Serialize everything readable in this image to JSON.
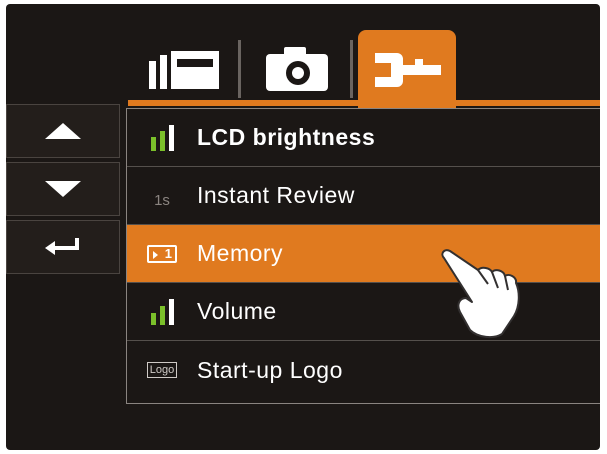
{
  "tabs": [
    {
      "id": "playback",
      "icon": "playback-mode-icon",
      "active": false
    },
    {
      "id": "camera",
      "icon": "camera-icon",
      "active": false
    },
    {
      "id": "settings",
      "icon": "wrench-icon",
      "active": true
    }
  ],
  "nav": [
    {
      "id": "up",
      "icon": "up-arrow-icon"
    },
    {
      "id": "down",
      "icon": "down-arrow-icon"
    },
    {
      "id": "enter",
      "icon": "enter-return-icon"
    }
  ],
  "menu": {
    "items": [
      {
        "label": "LCD brightness",
        "icon": "brightness-bars-icon",
        "selected": false
      },
      {
        "label": "Instant Review",
        "icon": "review-time-icon",
        "icon_text": "1s",
        "selected": false
      },
      {
        "label": "Memory",
        "icon": "memory-card-icon",
        "icon_text": "1",
        "selected": true
      },
      {
        "label": "Volume",
        "icon": "volume-bars-icon",
        "selected": false
      },
      {
        "label": "Start-up Logo",
        "icon": "logo-icon",
        "icon_text": "Logo",
        "selected": false
      }
    ]
  },
  "colors": {
    "accent": "#e07a1f",
    "background": "#1b1715",
    "level_green": "#7bc02a",
    "text": "#ffffff"
  }
}
